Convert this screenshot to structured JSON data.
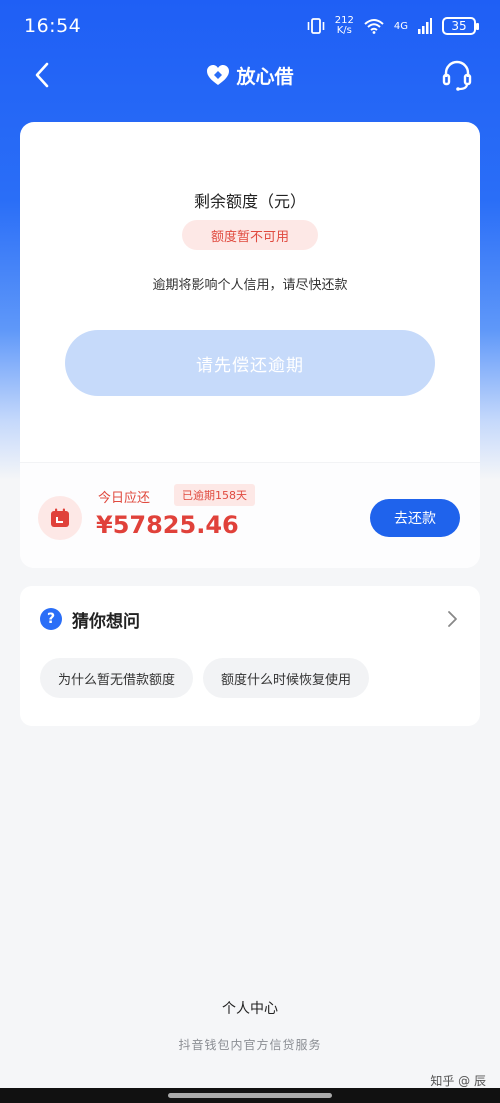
{
  "status_bar": {
    "time": "16:54",
    "net_speed_value": "212",
    "net_speed_unit": "K/s",
    "network": "4G",
    "battery": "35"
  },
  "nav": {
    "back_icon": "chevron-left-icon",
    "title": "放心借",
    "support_icon": "headset-icon"
  },
  "credit": {
    "label": "剩余额度（元）",
    "status": "额度暂不可用",
    "warning": "逾期将影响个人信用，请尽快还款",
    "action_label": "请先偿还逾期"
  },
  "due": {
    "icon": "calendar-icon",
    "label": "今日应还",
    "overdue_badge": "已逾期158天",
    "amount": "¥57825.46",
    "repay_label": "去还款"
  },
  "faq": {
    "icon": "question-icon",
    "title": "猜你想问",
    "arrow_icon": "chevron-right-icon",
    "questions": [
      "为什么暂无借款额度",
      "额度什么时候恢复使用"
    ]
  },
  "footer": {
    "title": "个人中心",
    "subtitle": "抖音钱包内官方信贷服务"
  },
  "watermark": "知乎 @   辰",
  "colors": {
    "brand_blue": "#1f63ec",
    "alert_red": "#e0413a",
    "alert_bg": "#fde8e6",
    "disabled_button": "#c6dafa"
  }
}
